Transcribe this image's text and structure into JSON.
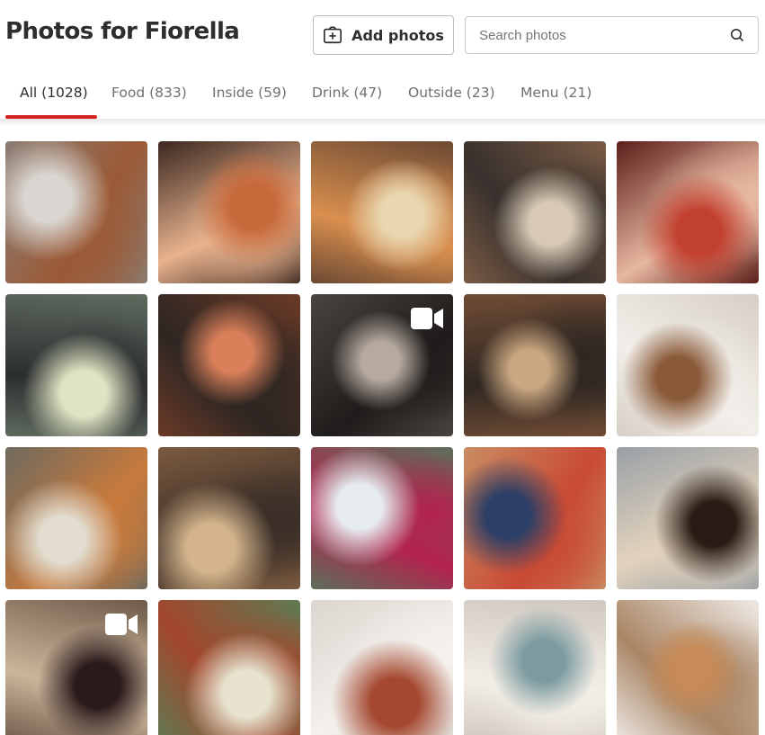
{
  "header": {
    "title": "Photos for Fiorella",
    "add_photos_label": "Add photos",
    "search_placeholder": "Search photos"
  },
  "tabs": [
    {
      "label": "All (1028)",
      "active": true
    },
    {
      "label": "Food (833)",
      "active": false
    },
    {
      "label": "Inside (59)",
      "active": false
    },
    {
      "label": "Drink (47)",
      "active": false
    },
    {
      "label": "Outside (23)",
      "active": false
    },
    {
      "label": "Menu (21)",
      "active": false
    }
  ],
  "colors": {
    "accent": "#d32323",
    "text": "#2d2e2f",
    "muted": "#6e7072",
    "border": "#bbbac0"
  },
  "photos": [
    {
      "subject": "food",
      "video": false,
      "palette": [
        "#8a7d73",
        "#d9d5d0",
        "#9b5a36"
      ]
    },
    {
      "subject": "inside",
      "video": false,
      "palette": [
        "#3b2820",
        "#c7693a",
        "#e8b28d"
      ]
    },
    {
      "subject": "food",
      "video": false,
      "palette": [
        "#6d4a33",
        "#e9d7b0",
        "#d98f4e"
      ]
    },
    {
      "subject": "inside",
      "video": false,
      "palette": [
        "#7a5b45",
        "#d7c9b5",
        "#38312d"
      ]
    },
    {
      "subject": "inside",
      "video": false,
      "palette": [
        "#5c1e1a",
        "#c2402f",
        "#e7b7a0"
      ]
    },
    {
      "subject": "drink",
      "video": false,
      "palette": [
        "#5f6b5f",
        "#dfe5c3",
        "#2c2e30"
      ]
    },
    {
      "subject": "inside",
      "video": false,
      "palette": [
        "#6a3a27",
        "#d9805a",
        "#2e2622"
      ]
    },
    {
      "subject": "inside",
      "video": true,
      "palette": [
        "#4a4440",
        "#b6aaa0",
        "#1f1c1b"
      ]
    },
    {
      "subject": "inside",
      "video": false,
      "palette": [
        "#6f4c35",
        "#c9a780",
        "#2f2722"
      ]
    },
    {
      "subject": "food",
      "video": false,
      "palette": [
        "#d6cfc6",
        "#8a5a38",
        "#f2eee9"
      ]
    },
    {
      "subject": "drink",
      "video": false,
      "palette": [
        "#6f6a5e",
        "#e2ddd0",
        "#c87a3c"
      ]
    },
    {
      "subject": "inside",
      "video": false,
      "palette": [
        "#7b5a3f",
        "#d3b48b",
        "#3a2e27"
      ]
    },
    {
      "subject": "drink",
      "video": false,
      "palette": [
        "#5d6e5a",
        "#e6ecef",
        "#b3234e"
      ]
    },
    {
      "subject": "outside",
      "video": false,
      "palette": [
        "#c98d62",
        "#2c3f66",
        "#c94a35"
      ]
    },
    {
      "subject": "drink",
      "video": false,
      "palette": [
        "#9aa0a6",
        "#2a1c14",
        "#e3d3bd"
      ]
    },
    {
      "subject": "drink",
      "video": true,
      "palette": [
        "#6f5a4a",
        "#2b1a1c",
        "#cbb59a"
      ]
    },
    {
      "subject": "drink",
      "video": false,
      "palette": [
        "#5f7a52",
        "#e7e3cf",
        "#a3462c"
      ]
    },
    {
      "subject": "food",
      "video": false,
      "palette": [
        "#dcd5cf",
        "#a4482f",
        "#f4f0ec"
      ]
    },
    {
      "subject": "food",
      "video": false,
      "palette": [
        "#cfc8c0",
        "#7b9ba0",
        "#f3eee6"
      ]
    },
    {
      "subject": "food",
      "video": false,
      "palette": [
        "#efe9e5",
        "#c88a56",
        "#a98665"
      ]
    }
  ]
}
